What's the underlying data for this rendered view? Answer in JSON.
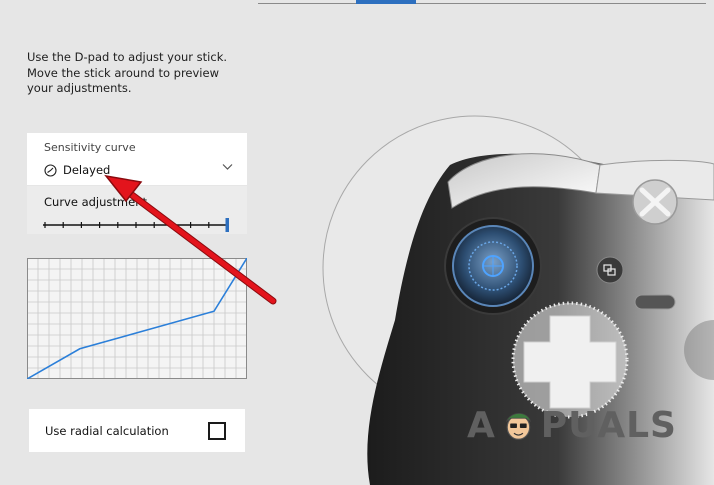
{
  "instructions": {
    "lines": [
      "Use the D-pad to adjust your stick.",
      "Move the stick around to preview",
      "your adjustments."
    ]
  },
  "sensitivity": {
    "label": "Sensitivity curve",
    "selected": "Delayed",
    "icon": "gauge-icon"
  },
  "curve_adjustment": {
    "label": "Curve adjustment",
    "level_fraction": 1.0,
    "tick_count": 11
  },
  "curve_graph": {
    "points": [
      [
        0,
        0
      ],
      [
        0.24,
        0.25
      ],
      [
        0.85,
        0.56
      ],
      [
        1,
        1
      ]
    ],
    "grid_columns": 20,
    "grid_rows": 11
  },
  "radial": {
    "label": "Use radial calculation",
    "checked": false
  },
  "watermark": {
    "letter_a": "A",
    "rest": "PUALS"
  },
  "colors": {
    "accent": "#2d6fbf",
    "arrow": "#e3141c",
    "background": "#e6e6e6",
    "card": "#ffffff"
  }
}
